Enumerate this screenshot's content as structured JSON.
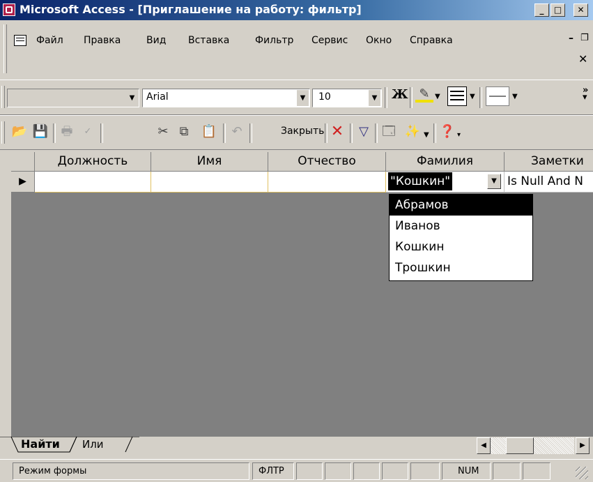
{
  "window": {
    "title": "Microsoft Access - [Приглашение на работу: фильтр]"
  },
  "menu": {
    "items": [
      "Файл",
      "Правка",
      "Вид",
      "Вставка",
      "Фильтр",
      "Сервис",
      "Окно",
      "Справка"
    ]
  },
  "format_toolbar": {
    "object_combo_value": "",
    "font_name": "Arial",
    "font_size": "10",
    "bold_label": "Ж"
  },
  "filter_toolbar": {
    "close_label": "Закрыть"
  },
  "datasheet": {
    "columns": [
      "Должность",
      "Имя",
      "Отчество",
      "Фамилия",
      "Заметки"
    ],
    "row": {
      "Должность": "",
      "Имя": "",
      "Отчество": "",
      "Фамилия": "\"Кошкин\"",
      "Заметки": "Is Null And N"
    },
    "dropdown_options": [
      "Абрамов",
      "Иванов",
      "Кошкин",
      "Трошкин"
    ],
    "dropdown_highlighted": "Абрамов"
  },
  "tabs": [
    "Найти",
    "Или"
  ],
  "statusbar": {
    "mode": "Режим формы",
    "filter": "ФЛТР",
    "numlock": "NUM"
  }
}
